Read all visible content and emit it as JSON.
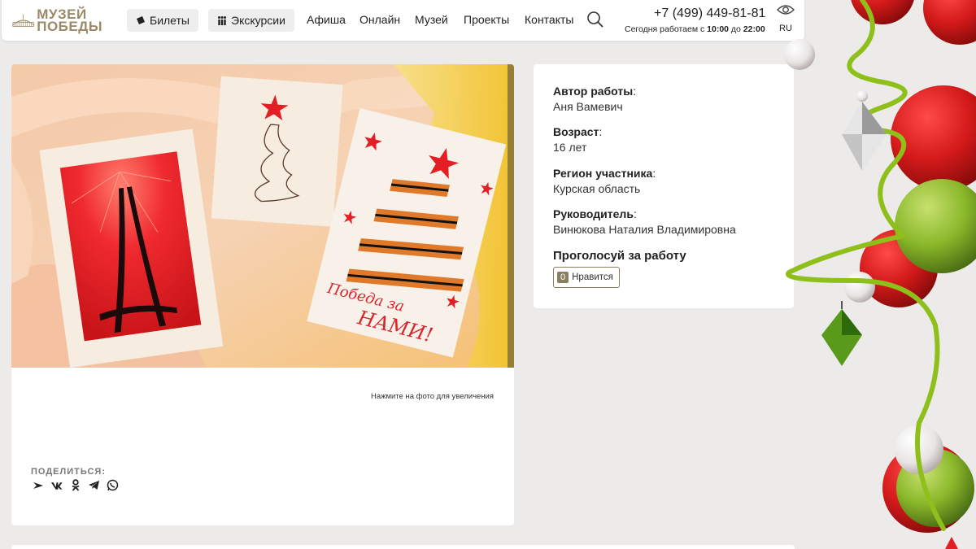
{
  "header": {
    "logo_line1": "МУЗЕЙ",
    "logo_line2": "ПОБЕДЫ",
    "tickets_label": "Билеты",
    "excursions_label": "Экскурсии",
    "nav": [
      "Афиша",
      "Онлайн",
      "Музей",
      "Проекты",
      "Контакты"
    ],
    "phone": "+7 (499) 449-81-81",
    "hours_prefix": "Сегодня работаем с",
    "hours_from": "10:00",
    "hours_mid": "до",
    "hours_to": "22:00",
    "lang": "RU"
  },
  "artwork": {
    "photo_hint": "Нажмите на фото для увеличения",
    "card_inscription_1": "Победа за",
    "card_inscription_2": "НАМИ!",
    "share_label": "ПОДЕЛИТЬСЯ:",
    "share_icons": [
      "yandex-icon",
      "vk-icon",
      "ok-icon",
      "telegram-icon",
      "whatsapp-icon"
    ]
  },
  "info": {
    "author_label": "Автор работы",
    "author_value": "Аня Вамевич",
    "age_label": "Возраст",
    "age_value": "16 лет",
    "region_label": "Регион участника",
    "region_value": "Курская область",
    "mentor_label": "Руководитель",
    "mentor_value": "Винюкова Наталия Владимировна",
    "colon": ":",
    "vote_title": "Проголосуй за работу",
    "likes_count": "0",
    "like_label": "Нравится"
  },
  "colors": {
    "accent": "#8a7f60",
    "logo": "#9a8a6a",
    "card_red": "#e8262a"
  }
}
